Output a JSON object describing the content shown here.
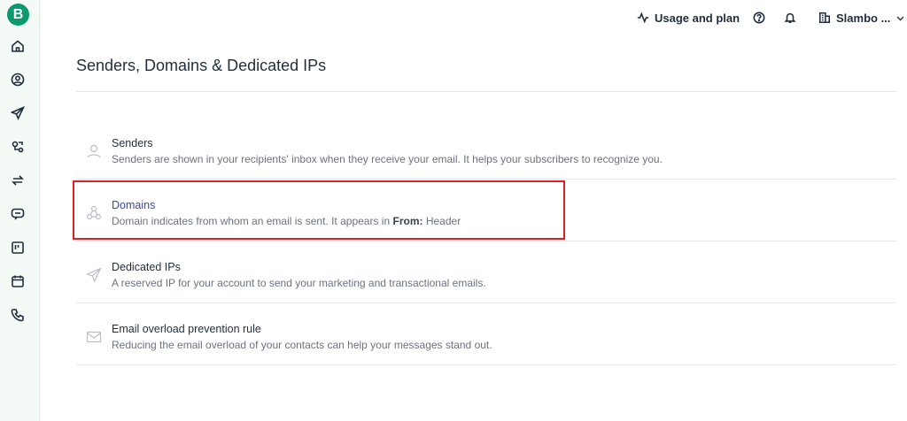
{
  "sidebar": {
    "logo_letter": "B",
    "brand_color": "#0b996e",
    "items": [
      {
        "icon": "home-icon"
      },
      {
        "icon": "contacts-icon"
      },
      {
        "icon": "send-icon"
      },
      {
        "icon": "automation-icon"
      },
      {
        "icon": "transactional-icon"
      },
      {
        "icon": "conversations-icon"
      },
      {
        "icon": "deals-icon"
      },
      {
        "icon": "meetings-icon"
      },
      {
        "icon": "phone-icon"
      }
    ]
  },
  "topbar": {
    "usage_label": "Usage and plan",
    "account_label": "Slambo ..."
  },
  "page": {
    "title": "Senders, Domains & Dedicated IPs"
  },
  "settings": [
    {
      "title": "Senders",
      "description": "Senders are shown in your recipients' inbox when they receive your email. It helps your subscribers to recognize you.",
      "icon": "user-icon"
    },
    {
      "title": "Domains",
      "description_prefix": "Domain indicates from whom an email is sent. It appears in",
      "description_bold": "From:",
      "description_suffix": "Header",
      "icon": "domain-nodes-icon",
      "highlighted": true
    },
    {
      "title": "Dedicated IPs",
      "description": "A reserved IP for your account to send your marketing and transactional emails.",
      "icon": "paper-plane-icon"
    },
    {
      "title": "Email overload prevention rule",
      "description": "Reducing the email overload of your contacts can help your messages stand out.",
      "icon": "envelope-icon"
    }
  ],
  "colors": {
    "highlight": "#e02020",
    "active_link": "#3c4a9b"
  }
}
